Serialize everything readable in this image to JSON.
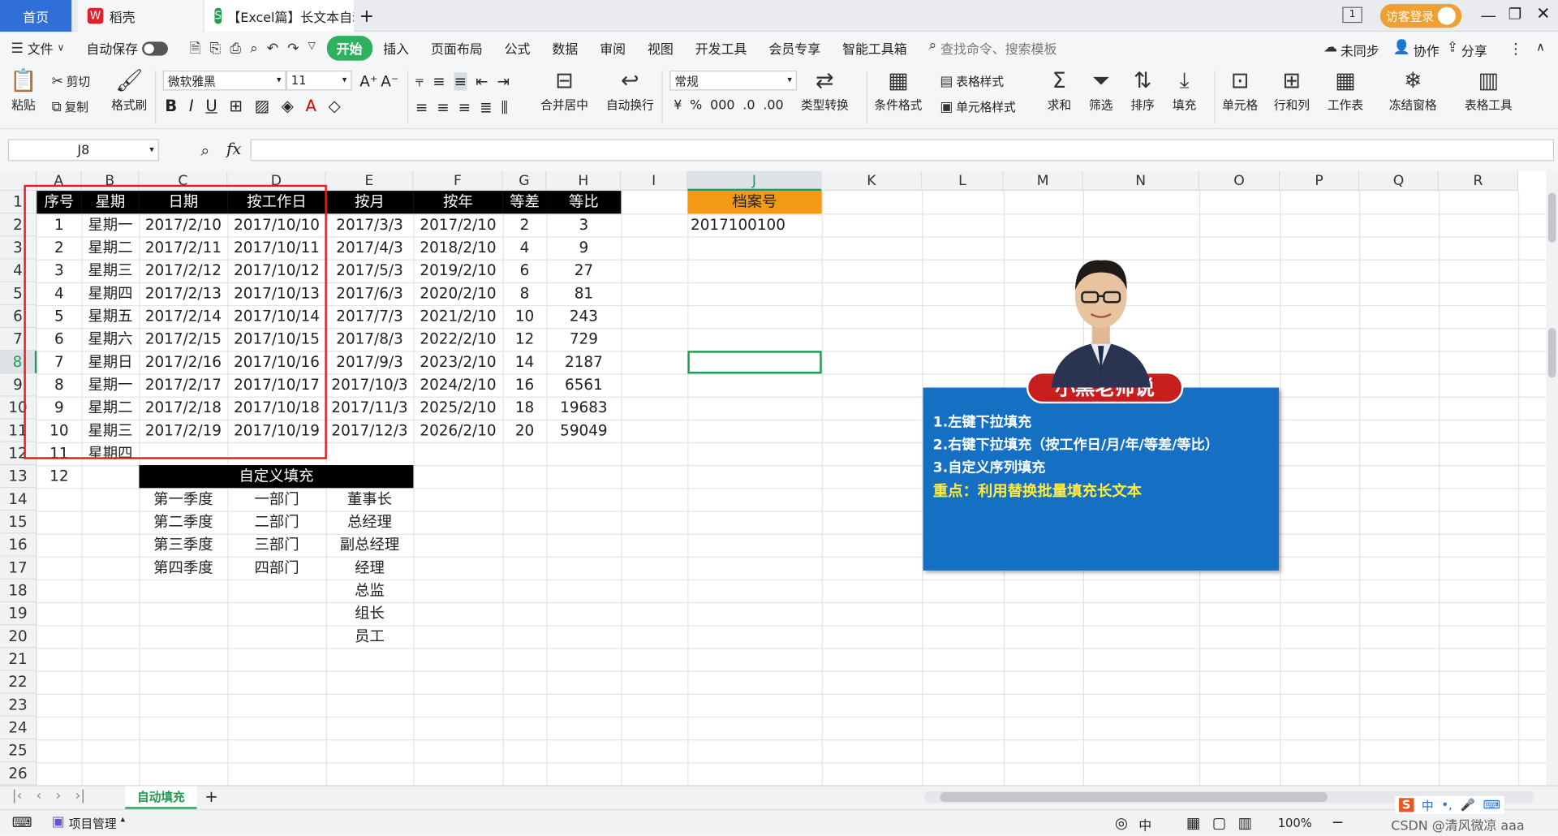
{
  "tabs": {
    "home": "首页",
    "daoke": "稻壳",
    "doc": "【Excel篇】长文本自动",
    "add": "+",
    "visitor": "访客登录"
  },
  "menu": {
    "file": "文件",
    "autosave": "自动保存",
    "items": [
      "开始",
      "插入",
      "页面布局",
      "公式",
      "数据",
      "审阅",
      "视图",
      "开发工具",
      "会员专享",
      "智能工具箱"
    ],
    "search": "查找命令、搜索模板",
    "unsynced": "未同步",
    "collab": "协作",
    "share": "分享"
  },
  "ribbon": {
    "paste": "粘贴",
    "cut": "剪切",
    "copy": "复制",
    "format_painter": "格式刷",
    "font": "微软雅黑",
    "size": "11",
    "merge": "合并居中",
    "wrap": "自动换行",
    "numfmt": "常规",
    "convert": "类型转换",
    "cond": "条件格式",
    "tablestyle": "表格样式",
    "cellstyle": "单元格样式",
    "sum": "求和",
    "filter": "筛选",
    "sort": "排序",
    "fill": "填充",
    "cell": "单元格",
    "rowcol": "行和列",
    "sheet": "工作表",
    "freeze": "冻结窗格",
    "tabletools": "表格工具"
  },
  "formula": {
    "namebox": "J8",
    "fx": "fx",
    "value": ""
  },
  "columns": [
    "A",
    "B",
    "C",
    "D",
    "E",
    "F",
    "G",
    "H",
    "I",
    "J",
    "K",
    "L",
    "M",
    "N",
    "O",
    "P",
    "Q",
    "R"
  ],
  "rows": [
    "1",
    "2",
    "3",
    "4",
    "5",
    "6",
    "7",
    "8",
    "9",
    "10",
    "11",
    "12",
    "13",
    "14",
    "15",
    "16",
    "17",
    "18",
    "19",
    "20",
    "21",
    "22",
    "23",
    "24",
    "25",
    "26"
  ],
  "table": {
    "headers": [
      "序号",
      "星期",
      "日期",
      "按工作日",
      "按月",
      "按年",
      "等差",
      "等比"
    ],
    "data": [
      [
        "1",
        "星期一",
        "2017/2/10",
        "2017/10/10",
        "2017/3/3",
        "2017/2/10",
        "2",
        "3"
      ],
      [
        "2",
        "星期二",
        "2017/2/11",
        "2017/10/11",
        "2017/4/3",
        "2018/2/10",
        "4",
        "9"
      ],
      [
        "3",
        "星期三",
        "2017/2/12",
        "2017/10/12",
        "2017/5/3",
        "2019/2/10",
        "6",
        "27"
      ],
      [
        "4",
        "星期四",
        "2017/2/13",
        "2017/10/13",
        "2017/6/3",
        "2020/2/10",
        "8",
        "81"
      ],
      [
        "5",
        "星期五",
        "2017/2/14",
        "2017/10/14",
        "2017/7/3",
        "2021/2/10",
        "10",
        "243"
      ],
      [
        "6",
        "星期六",
        "2017/2/15",
        "2017/10/15",
        "2017/8/3",
        "2022/2/10",
        "12",
        "729"
      ],
      [
        "7",
        "星期日",
        "2017/2/16",
        "2017/10/16",
        "2017/9/3",
        "2023/2/10",
        "14",
        "2187"
      ],
      [
        "8",
        "星期一",
        "2017/2/17",
        "2017/10/17",
        "2017/10/3",
        "2024/2/10",
        "16",
        "6561"
      ],
      [
        "9",
        "星期二",
        "2017/2/18",
        "2017/10/18",
        "2017/11/3",
        "2025/2/10",
        "18",
        "19683"
      ],
      [
        "10",
        "星期三",
        "2017/2/19",
        "2017/10/19",
        "2017/12/3",
        "2026/2/10",
        "20",
        "59049"
      ]
    ],
    "row12": [
      "11",
      "星期四"
    ],
    "row13": "12"
  },
  "custom": {
    "title": "自定义填充",
    "col1": [
      "第一季度",
      "第二季度",
      "第三季度",
      "第四季度"
    ],
    "col2": [
      "一部门",
      "二部门",
      "三部门",
      "四部门"
    ],
    "col3": [
      "董事长",
      "总经理",
      "副总经理",
      "经理",
      "总监",
      "组长",
      "员工"
    ]
  },
  "archive": {
    "header": "档案号",
    "value": "2017100100"
  },
  "card": {
    "title": "小黑老师说",
    "lines": [
      "1.左键下拉填充",
      "2.右键下拉填充（按工作日/月/年/等差/等比）",
      "3.自定义序列填充"
    ],
    "highlight": "重点：利用替换批量填充长文本"
  },
  "sheet": {
    "name": "自动填充"
  },
  "status": {
    "project": "项目管理",
    "zoom": "100%",
    "watermark": "CSDN @清风微凉 aaa"
  },
  "colors": {
    "accent": "#2fb160",
    "header_bg": "#000000",
    "archive_bg": "#f59a14",
    "card_bg": "#1570c4",
    "card_title_bg": "#c81e1e",
    "highlight_text": "#ffeb3b",
    "frame": "#e02020"
  }
}
